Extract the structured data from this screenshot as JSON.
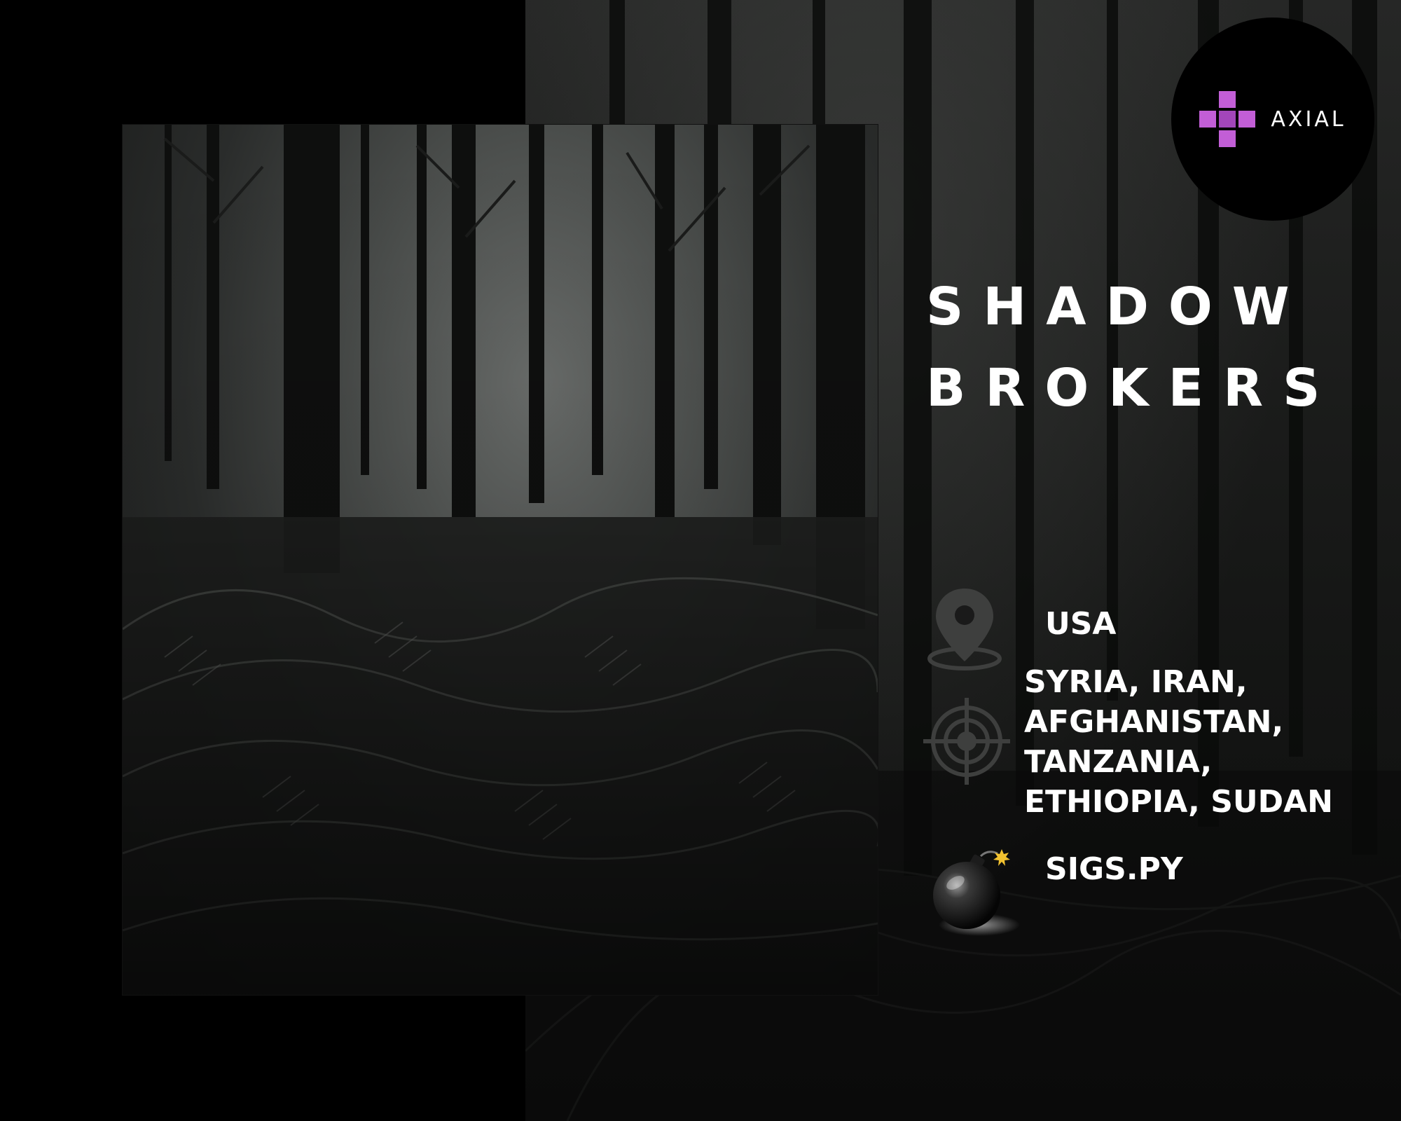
{
  "brand": {
    "name": "AXIAL",
    "accent_color": "#c25ed6",
    "logo_icon": "plus-cross-logo-icon"
  },
  "poster": {
    "title_line1": "SHADOW",
    "title_line2": "BROKERS",
    "background": "dark forest with ferns",
    "text_color": "#ffffff"
  },
  "details": {
    "origin": {
      "icon": "location-pin-icon",
      "value": "USA"
    },
    "targets": {
      "icon": "crosshair-target-icon",
      "lines": [
        "SYRIA, IRAN,",
        "AFGHANISTAN,",
        "TANZANIA,",
        "ETHIOPIA, SUDAN"
      ]
    },
    "tool": {
      "icon": "bomb-icon",
      "value": "SIGS.PY"
    }
  }
}
